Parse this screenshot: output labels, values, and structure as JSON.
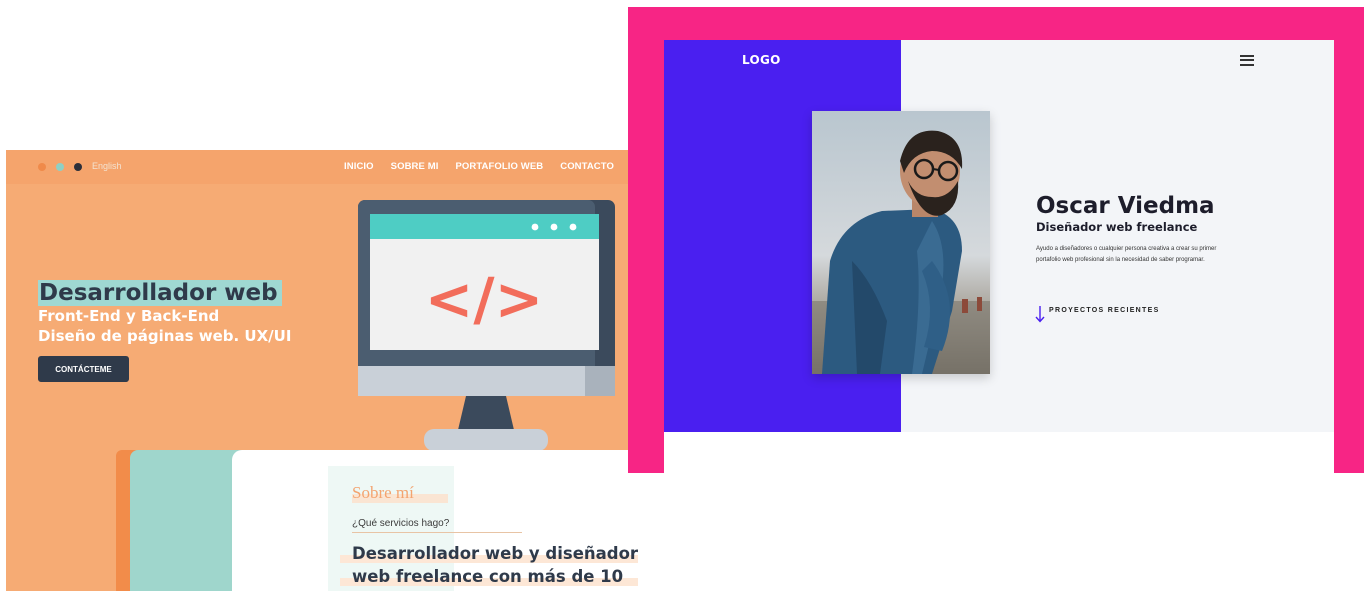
{
  "left_site": {
    "lang_label": "English",
    "nav": [
      "INICIO",
      "SOBRE MI",
      "PORTAFOLIO WEB",
      "CONTACTO"
    ],
    "hero": {
      "title": "Desarrollador web",
      "line1": "Front-End y Back-End",
      "line2": "Diseño de páginas web. UX/UI",
      "button": "CONTÁCTEME"
    },
    "code_symbol": "</>",
    "about": {
      "title": "Sobre mí",
      "question": "¿Qué servicios hago?",
      "body_line1": "Desarrollador web y diseñador",
      "body_line2": "web freelance con más de 10"
    },
    "colors": {
      "background": "#f6ab74",
      "dark": "#2f3a4a",
      "teal": "#4ecdc4",
      "accent": "#f26d5b"
    }
  },
  "right_site": {
    "logo": "LOGO",
    "menu_icon": "hamburger-menu-icon",
    "name": "Oscar Viedma",
    "role": "Diseñador web freelance",
    "description": "Ayudo a diseñadores o cualquier persona creativa a crear su primer portafolio web profesional sin la necesidad de saber programar.",
    "cta": "PROYECTOS RECIENTES",
    "cta_icon": "arrow-down-icon",
    "colors": {
      "frame": "#f72585",
      "panel": "#4a1ff0",
      "background": "#f3f5f8"
    }
  }
}
